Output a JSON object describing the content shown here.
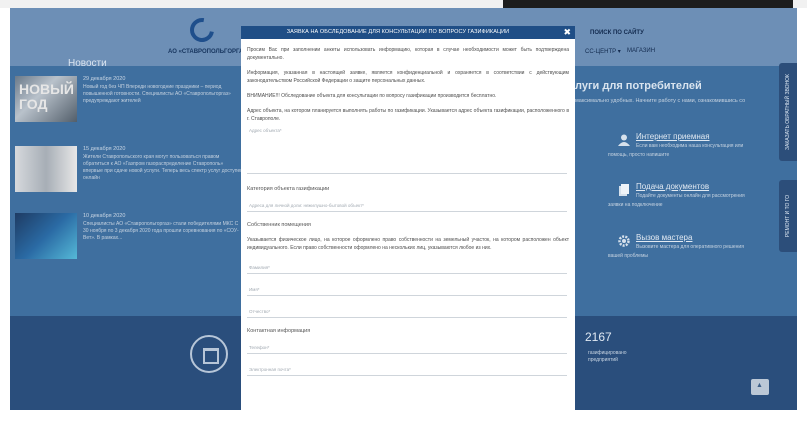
{
  "header": {
    "logo_text": "АО «СТАВРОПОЛЬГОРГАЗ»",
    "search_label": "ПОИСК ПО САЙТУ",
    "nav_item_1": "СС-ЦЕНТР ▾",
    "nav_item_2": "МАГАЗИН"
  },
  "news": {
    "title": "Новости",
    "items": [
      {
        "date": "29 декабря 2020",
        "body": "Новый год без ЧП\nВпереди новогодние праздники – период повышенной готовности. Специалисты АО «Ставропольгоргаз» предупреждают жителей"
      },
      {
        "date": "15 декабря 2020",
        "body": "Жители Ставропольского края могут пользоваться правом обратиться к АО «Газпром газораспределение Ставрополь» впервые при сдаче новой услуги. Теперь весь спектр услуг доступен онлайн"
      },
      {
        "date": "10 декабря 2020",
        "body": "Специалисты АО «Ставропольгоргаз» стали победителями МКС\nС 30 ноября по 3 декабря 2020 года прошли соревнования по «СОУ-Вет». В рамках..."
      }
    ]
  },
  "consumers": {
    "title": "луги для потребителей",
    "subtitle": "максимально удобных. Начните работу с нами, ознакомившись со",
    "services": [
      {
        "title": "Интернет приемная",
        "desc": "Если вам необходима наша консультация или",
        "desc2": "помощь, просто напишите"
      },
      {
        "title": "Подача документов",
        "desc": "Подайте документы онлайн для рассмотрения",
        "desc2": "заявки на подключение"
      },
      {
        "title": "Вызов мастера",
        "desc": "Вызовите мастера для оперативного решения",
        "desc2": "вашей проблемы"
      }
    ],
    "side_tab_1": "ЗАКАЗАТЬ ОБРАТНЫЙ ЗВОНОК",
    "side_tab_2": "РЕМОНТ И ТО ГО"
  },
  "footer": {
    "stat_number": "2167",
    "stat_label": "газифицировано\nпредприятий"
  },
  "modal": {
    "title": "ЗАЯВКА НА ОБСЛЕДОВАНИЕ ДЛЯ КОНСУЛЬТАЦИИ ПО ВОПРОСУ ГАЗИФИКАЦИИ",
    "close_label": "✖",
    "para_1": "Просим Вас при заполнении анкеты использовать информацию, которая в случае необходимости может быть подтверждена документально.",
    "para_2": "Информация, указанная в настоящей заявке, является конфиденциальной и охраняется в соответствии с действующим законодательством Российской Федерации о защите персональных данных.",
    "para_3": "ВНИМАНИЕ!!! Обследование объекта для консультации по вопросу газификации производится бесплатно.",
    "para_4": "Адрес объекта, на котором планируется выполнять работы по газификации. Указывается адрес объекта газификации, расположенного в г. Ставрополе.",
    "address_placeholder": "Адрес объекта*",
    "category_label": "Категория объекта газификации",
    "category_placeholder": "Адреса для личной доли: нежилушно-бытовой объект*",
    "ownership_label": "Собственник помещения",
    "ownership_text": "Указывается физическое лицо, на которое оформлено право собственности на земельный участок, на котором расположен объект индивидуального. Если право собственности оформлено на нескольких лиц, указываются любое из них.",
    "surname_placeholder": "Фамилия*",
    "name_placeholder": "Имя*",
    "patronymic_placeholder": "Отчество*",
    "contact_label": "Контактная информация",
    "phone_placeholder": "Телефон*",
    "email_placeholder": "Электронная почта*"
  }
}
